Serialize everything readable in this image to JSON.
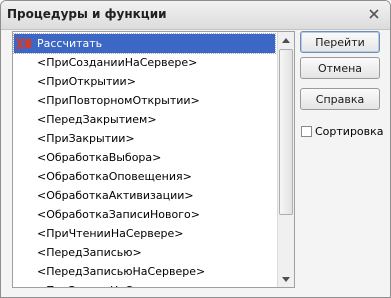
{
  "window": {
    "title": "Процедуры и функции"
  },
  "list": {
    "items": [
      "Рассчитать",
      "<ПриСозданииНаСервере>",
      "<ПриОткрытии>",
      "<ПриПовторномОткрытии>",
      "<ПередЗакрытием>",
      "<ПриЗакрытии>",
      "<ОбработкаВыбора>",
      "<ОбработкаОповещения>",
      "<ОбработкаАктивизации>",
      "<ОбработкаЗаписиНового>",
      "<ПриЧтенииНаСервере>",
      "<ПередЗаписью>",
      "<ПередЗаписьюНаСервере>",
      "<ПриЗаписиНаСервере>"
    ],
    "selected_index": 0
  },
  "buttons": {
    "go": "Перейти",
    "cancel": "Отмена",
    "help": "Справка"
  },
  "sort_checkbox": {
    "label": "Сортировка",
    "checked": false
  },
  "colors": {
    "selection": "#3d67c4",
    "mark": "#d23a2a"
  }
}
